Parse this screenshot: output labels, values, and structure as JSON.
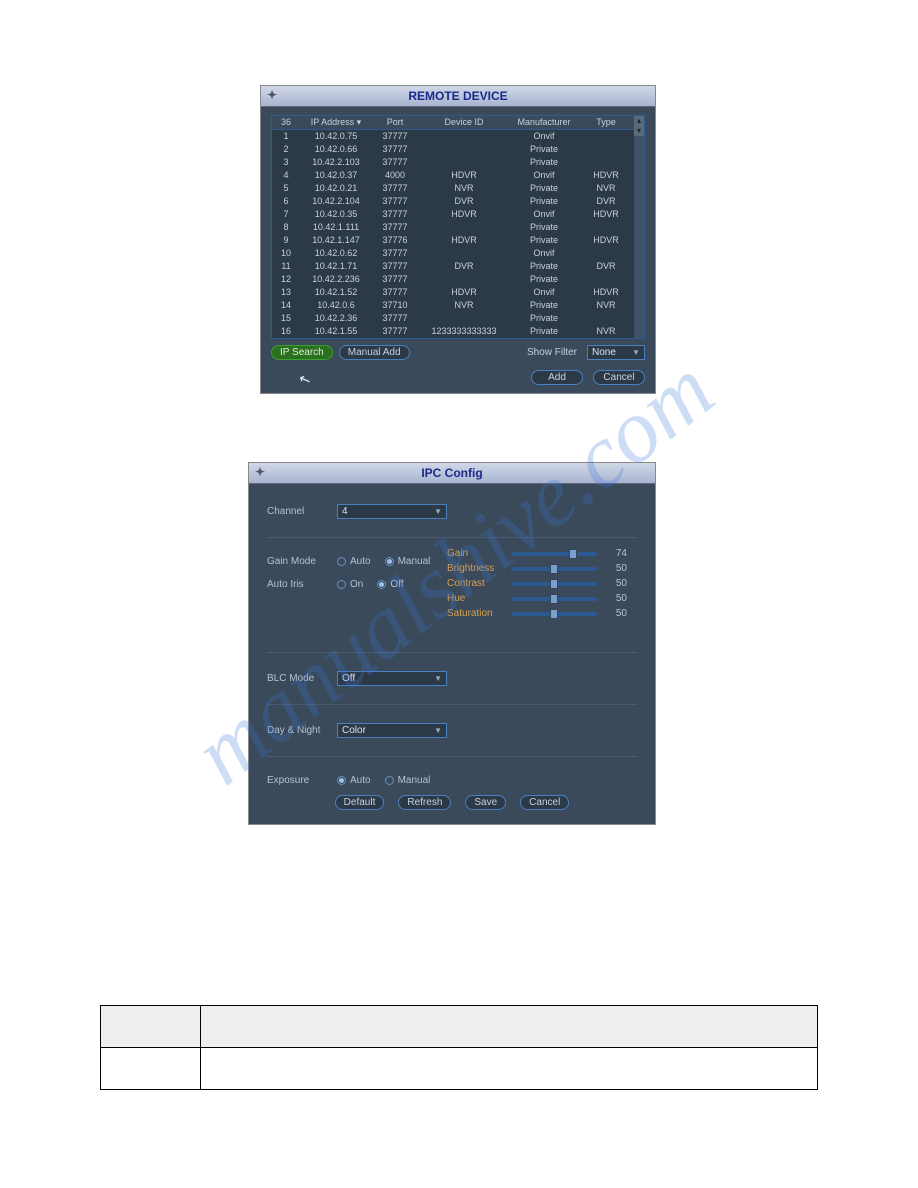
{
  "watermark": "manualshive.com",
  "remote": {
    "title": "REMOTE DEVICE",
    "headers": {
      "count": "36",
      "ip": "IP Address ▾",
      "port": "Port",
      "did": "Device ID",
      "man": "Manufacturer",
      "type": "Type"
    },
    "rows": [
      {
        "n": "1",
        "ip": "10.42.0.75",
        "port": "37777",
        "did": "",
        "man": "Onvif",
        "type": ""
      },
      {
        "n": "2",
        "ip": "10.42.0.66",
        "port": "37777",
        "did": "",
        "man": "Private",
        "type": ""
      },
      {
        "n": "3",
        "ip": "10.42.2.103",
        "port": "37777",
        "did": "",
        "man": "Private",
        "type": ""
      },
      {
        "n": "4",
        "ip": "10.42.0.37",
        "port": "4000",
        "did": "HDVR",
        "man": "Onvif",
        "type": "HDVR"
      },
      {
        "n": "5",
        "ip": "10.42.0.21",
        "port": "37777",
        "did": "NVR",
        "man": "Private",
        "type": "NVR"
      },
      {
        "n": "6",
        "ip": "10.42.2.104",
        "port": "37777",
        "did": "DVR",
        "man": "Private",
        "type": "DVR"
      },
      {
        "n": "7",
        "ip": "10.42.0.35",
        "port": "37777",
        "did": "HDVR",
        "man": "Onvif",
        "type": "HDVR"
      },
      {
        "n": "8",
        "ip": "10.42.1.111",
        "port": "37777",
        "did": "",
        "man": "Private",
        "type": ""
      },
      {
        "n": "9",
        "ip": "10.42.1.147",
        "port": "37776",
        "did": "HDVR",
        "man": "Private",
        "type": "HDVR"
      },
      {
        "n": "10",
        "ip": "10.42.0.62",
        "port": "37777",
        "did": "",
        "man": "Onvif",
        "type": ""
      },
      {
        "n": "11",
        "ip": "10.42.1.71",
        "port": "37777",
        "did": "DVR",
        "man": "Private",
        "type": "DVR"
      },
      {
        "n": "12",
        "ip": "10.42.2.236",
        "port": "37777",
        "did": "",
        "man": "Private",
        "type": ""
      },
      {
        "n": "13",
        "ip": "10.42.1.52",
        "port": "37777",
        "did": "HDVR",
        "man": "Onvif",
        "type": "HDVR"
      },
      {
        "n": "14",
        "ip": "10.42.0.6",
        "port": "37710",
        "did": "NVR",
        "man": "Private",
        "type": "NVR"
      },
      {
        "n": "15",
        "ip": "10.42.2.36",
        "port": "37777",
        "did": "",
        "man": "Private",
        "type": ""
      },
      {
        "n": "16",
        "ip": "10.42.1.55",
        "port": "37777",
        "did": "1233333333333",
        "man": "Private",
        "type": "NVR"
      }
    ],
    "ip_search": "IP Search",
    "manual_add": "Manual Add",
    "show_filter_label": "Show Filter",
    "show_filter_value": "None",
    "add": "Add",
    "cancel": "Cancel"
  },
  "ipc": {
    "title": "IPC Config",
    "channel_label": "Channel",
    "channel_value": "4",
    "gain_mode_label": "Gain Mode",
    "gain_auto": "Auto",
    "gain_manual": "Manual",
    "auto_iris_label": "Auto Iris",
    "iris_on": "On",
    "iris_off": "Off",
    "sliders": [
      {
        "label": "Gain",
        "value": "74",
        "pct": 74
      },
      {
        "label": "Brightness",
        "value": "50",
        "pct": 50
      },
      {
        "label": "Contrast",
        "value": "50",
        "pct": 50
      },
      {
        "label": "Hue",
        "value": "50",
        "pct": 50
      },
      {
        "label": "Saturation",
        "value": "50",
        "pct": 50
      }
    ],
    "blc_label": "BLC Mode",
    "blc_value": "Off",
    "daynight_label": "Day & Night",
    "daynight_value": "Color",
    "exposure_label": "Exposure",
    "exp_auto": "Auto",
    "exp_manual": "Manual",
    "default": "Default",
    "refresh": "Refresh",
    "save": "Save",
    "cancel": "Cancel"
  }
}
